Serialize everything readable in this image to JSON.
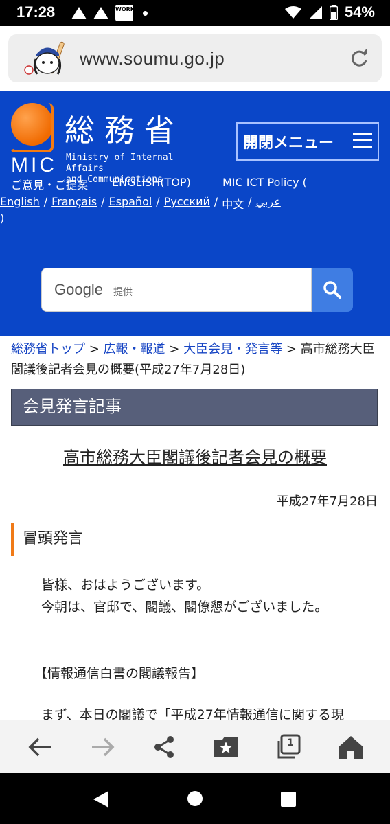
{
  "status": {
    "time": "17:28",
    "work_badge": "WORK",
    "battery": "54%"
  },
  "url_bar": {
    "url": "www.soumu.go.jp"
  },
  "header": {
    "logo_jp": "総務省",
    "logo_mic": "MIC",
    "logo_en_line1": "Ministry of Internal Affairs",
    "logo_en_line2": "and Communications",
    "menu_label": "開閉メニュー",
    "link_opinion": "ご意見・ご提案",
    "link_english": "ENGLISH(TOP)",
    "policy_label": "MIC ICT Policy (",
    "languages": [
      "English",
      "Français",
      "Español",
      "Русский",
      "中文",
      "عربي"
    ],
    "lang_sep": "/",
    "close_paren": ")",
    "search_brand": "Google",
    "search_provided": "提供"
  },
  "breadcrumb": {
    "items": [
      "総務省トップ",
      "広報・報道",
      "大臣会見・発言等"
    ],
    "separator": ">",
    "current": "高市総務大臣閣議後記者会見の概要(平成27年7月28日)"
  },
  "article": {
    "section_label": "会見発言記事",
    "title": "高市総務大臣閣議後記者会見の概要",
    "date": "平成27年7月28日",
    "subheading": "冒頭発言",
    "para1_line1": "皆様、おはようございます。",
    "para1_line2": "今朝は、官邸で、閣議、閣僚懇がございました。",
    "section_heading": "【情報通信白書の閣議報告】",
    "para2_partial": "まず、本日の閣議で「平成27年情報通信に関する現"
  },
  "toolbar": {
    "tab_count": "1"
  },
  "colors": {
    "header_blue": "#0a46c8",
    "logo_orange": "#f06a00",
    "section_bar": "#575f7a",
    "accent_orange": "#f07a17",
    "link_blue": "#1846c4"
  }
}
